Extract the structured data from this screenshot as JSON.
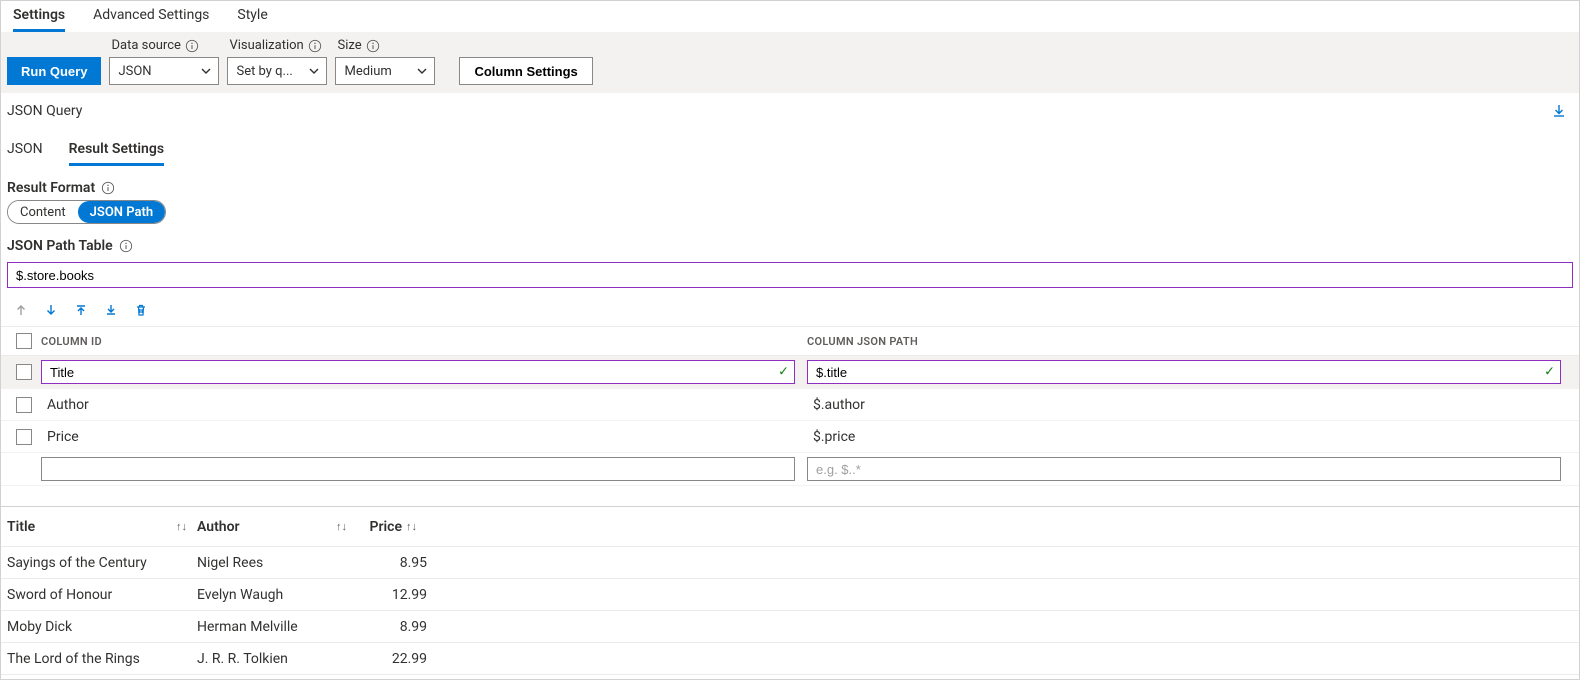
{
  "tabs": {
    "settings": "Settings",
    "advanced": "Advanced Settings",
    "style": "Style"
  },
  "toolbar": {
    "run": "Run Query",
    "datasource_label": "Data source",
    "datasource_value": "JSON",
    "viz_label": "Visualization",
    "viz_value": "Set by q...",
    "size_label": "Size",
    "size_value": "Medium",
    "column_settings": "Column Settings"
  },
  "section": {
    "json_query": "JSON Query"
  },
  "subtabs": {
    "json": "JSON",
    "result_settings": "Result Settings"
  },
  "result_format": {
    "label": "Result Format",
    "content": "Content",
    "json_path": "JSON Path"
  },
  "json_path_table": {
    "label": "JSON Path Table",
    "value": "$.store.books"
  },
  "columns": {
    "head_id": "COLUMN ID",
    "head_path": "COLUMN JSON PATH",
    "rows": [
      {
        "id": "Title",
        "path": "$.title",
        "editing": true
      },
      {
        "id": "Author",
        "path": "$.author",
        "editing": false
      },
      {
        "id": "Price",
        "path": "$.price",
        "editing": false
      }
    ],
    "new_placeholder_path": "e.g. $..*"
  },
  "results": {
    "headers": {
      "title": "Title",
      "author": "Author",
      "price": "Price"
    },
    "rows": [
      {
        "title": "Sayings of the Century",
        "author": "Nigel Rees",
        "price": "8.95"
      },
      {
        "title": "Sword of Honour",
        "author": "Evelyn Waugh",
        "price": "12.99"
      },
      {
        "title": "Moby Dick",
        "author": "Herman Melville",
        "price": "8.99"
      },
      {
        "title": "The Lord of the Rings",
        "author": "J. R. R. Tolkien",
        "price": "22.99"
      }
    ]
  }
}
